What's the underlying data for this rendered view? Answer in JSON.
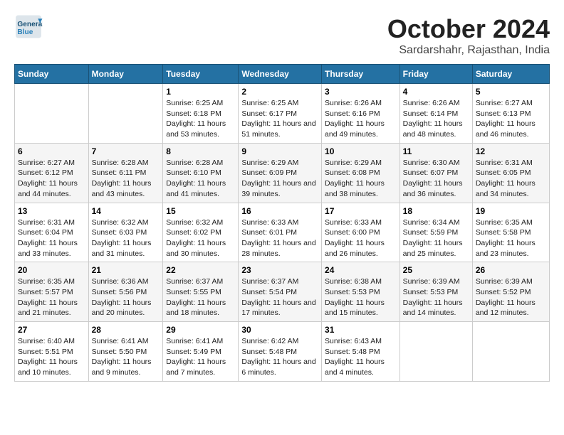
{
  "logo": {
    "general": "General",
    "blue": "Blue"
  },
  "title": "October 2024",
  "location": "Sardarshahr, Rajasthan, India",
  "days_of_week": [
    "Sunday",
    "Monday",
    "Tuesday",
    "Wednesday",
    "Thursday",
    "Friday",
    "Saturday"
  ],
  "weeks": [
    [
      {
        "day": "",
        "content": ""
      },
      {
        "day": "",
        "content": ""
      },
      {
        "day": "1",
        "content": "Sunrise: 6:25 AM\nSunset: 6:18 PM\nDaylight: 11 hours and 53 minutes."
      },
      {
        "day": "2",
        "content": "Sunrise: 6:25 AM\nSunset: 6:17 PM\nDaylight: 11 hours and 51 minutes."
      },
      {
        "day": "3",
        "content": "Sunrise: 6:26 AM\nSunset: 6:16 PM\nDaylight: 11 hours and 49 minutes."
      },
      {
        "day": "4",
        "content": "Sunrise: 6:26 AM\nSunset: 6:14 PM\nDaylight: 11 hours and 48 minutes."
      },
      {
        "day": "5",
        "content": "Sunrise: 6:27 AM\nSunset: 6:13 PM\nDaylight: 11 hours and 46 minutes."
      }
    ],
    [
      {
        "day": "6",
        "content": "Sunrise: 6:27 AM\nSunset: 6:12 PM\nDaylight: 11 hours and 44 minutes."
      },
      {
        "day": "7",
        "content": "Sunrise: 6:28 AM\nSunset: 6:11 PM\nDaylight: 11 hours and 43 minutes."
      },
      {
        "day": "8",
        "content": "Sunrise: 6:28 AM\nSunset: 6:10 PM\nDaylight: 11 hours and 41 minutes."
      },
      {
        "day": "9",
        "content": "Sunrise: 6:29 AM\nSunset: 6:09 PM\nDaylight: 11 hours and 39 minutes."
      },
      {
        "day": "10",
        "content": "Sunrise: 6:29 AM\nSunset: 6:08 PM\nDaylight: 11 hours and 38 minutes."
      },
      {
        "day": "11",
        "content": "Sunrise: 6:30 AM\nSunset: 6:07 PM\nDaylight: 11 hours and 36 minutes."
      },
      {
        "day": "12",
        "content": "Sunrise: 6:31 AM\nSunset: 6:05 PM\nDaylight: 11 hours and 34 minutes."
      }
    ],
    [
      {
        "day": "13",
        "content": "Sunrise: 6:31 AM\nSunset: 6:04 PM\nDaylight: 11 hours and 33 minutes."
      },
      {
        "day": "14",
        "content": "Sunrise: 6:32 AM\nSunset: 6:03 PM\nDaylight: 11 hours and 31 minutes."
      },
      {
        "day": "15",
        "content": "Sunrise: 6:32 AM\nSunset: 6:02 PM\nDaylight: 11 hours and 30 minutes."
      },
      {
        "day": "16",
        "content": "Sunrise: 6:33 AM\nSunset: 6:01 PM\nDaylight: 11 hours and 28 minutes."
      },
      {
        "day": "17",
        "content": "Sunrise: 6:33 AM\nSunset: 6:00 PM\nDaylight: 11 hours and 26 minutes."
      },
      {
        "day": "18",
        "content": "Sunrise: 6:34 AM\nSunset: 5:59 PM\nDaylight: 11 hours and 25 minutes."
      },
      {
        "day": "19",
        "content": "Sunrise: 6:35 AM\nSunset: 5:58 PM\nDaylight: 11 hours and 23 minutes."
      }
    ],
    [
      {
        "day": "20",
        "content": "Sunrise: 6:35 AM\nSunset: 5:57 PM\nDaylight: 11 hours and 21 minutes."
      },
      {
        "day": "21",
        "content": "Sunrise: 6:36 AM\nSunset: 5:56 PM\nDaylight: 11 hours and 20 minutes."
      },
      {
        "day": "22",
        "content": "Sunrise: 6:37 AM\nSunset: 5:55 PM\nDaylight: 11 hours and 18 minutes."
      },
      {
        "day": "23",
        "content": "Sunrise: 6:37 AM\nSunset: 5:54 PM\nDaylight: 11 hours and 17 minutes."
      },
      {
        "day": "24",
        "content": "Sunrise: 6:38 AM\nSunset: 5:53 PM\nDaylight: 11 hours and 15 minutes."
      },
      {
        "day": "25",
        "content": "Sunrise: 6:39 AM\nSunset: 5:53 PM\nDaylight: 11 hours and 14 minutes."
      },
      {
        "day": "26",
        "content": "Sunrise: 6:39 AM\nSunset: 5:52 PM\nDaylight: 11 hours and 12 minutes."
      }
    ],
    [
      {
        "day": "27",
        "content": "Sunrise: 6:40 AM\nSunset: 5:51 PM\nDaylight: 11 hours and 10 minutes."
      },
      {
        "day": "28",
        "content": "Sunrise: 6:41 AM\nSunset: 5:50 PM\nDaylight: 11 hours and 9 minutes."
      },
      {
        "day": "29",
        "content": "Sunrise: 6:41 AM\nSunset: 5:49 PM\nDaylight: 11 hours and 7 minutes."
      },
      {
        "day": "30",
        "content": "Sunrise: 6:42 AM\nSunset: 5:48 PM\nDaylight: 11 hours and 6 minutes."
      },
      {
        "day": "31",
        "content": "Sunrise: 6:43 AM\nSunset: 5:48 PM\nDaylight: 11 hours and 4 minutes."
      },
      {
        "day": "",
        "content": ""
      },
      {
        "day": "",
        "content": ""
      }
    ]
  ]
}
